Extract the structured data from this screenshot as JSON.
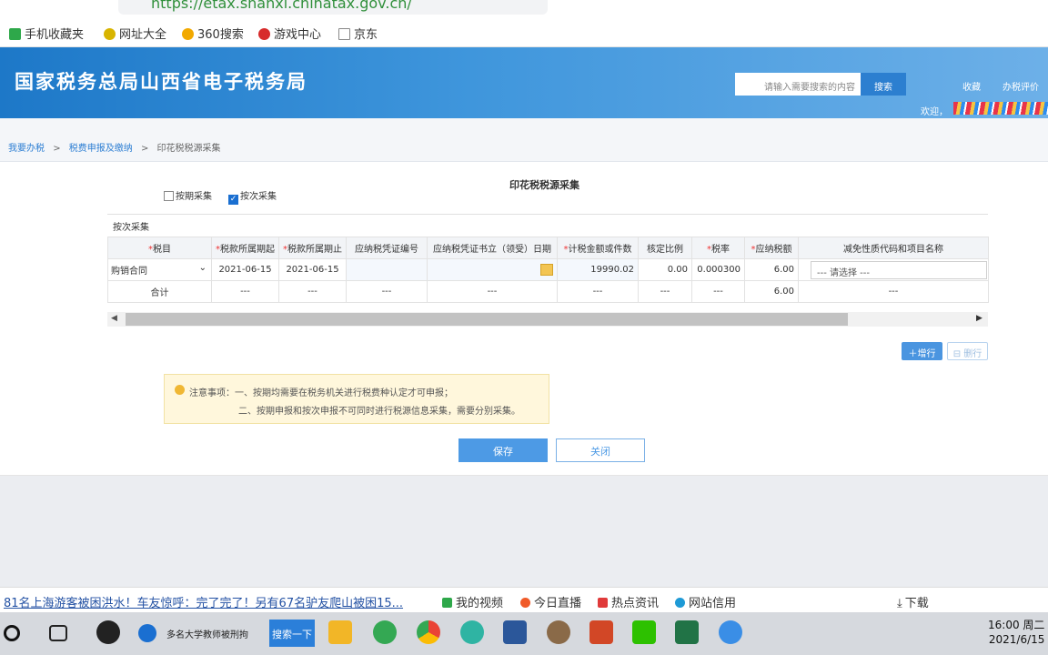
{
  "browser": {
    "address": "https://etax.shanxi.chinatax.gov.cn/",
    "bookmarks": [
      "手机收藏夹",
      "网址大全",
      "360搜索",
      "游戏中心",
      "京东"
    ]
  },
  "header": {
    "title": "国家税务总局山西省电子税务局",
    "search_placeholder": "请输入需要搜索的内容",
    "search_button": "搜索",
    "favorite": "收藏",
    "rate": "办税评价",
    "welcome": "欢迎，"
  },
  "breadcrumb": [
    "我要办税",
    "税费申报及缴纳",
    "印花税税源采集"
  ],
  "breadcrumb_sep": ">",
  "page_title": "印花税税源采集",
  "options": {
    "by_period": "按期采集",
    "by_time": "按次采集",
    "by_period_checked": false,
    "by_time_checked": true
  },
  "section_label": "按次采集",
  "table": {
    "headers": [
      {
        "text": "税目",
        "required": true
      },
      {
        "text": "税款所属期起",
        "required": true
      },
      {
        "text": "税款所属期止",
        "required": true
      },
      {
        "text": "应纳税凭证编号",
        "required": false
      },
      {
        "text": "应纳税凭证书立（领受）日期",
        "required": false
      },
      {
        "text": "计税金额或件数",
        "required": true
      },
      {
        "text": "核定比例",
        "required": false
      },
      {
        "text": "税率",
        "required": true
      },
      {
        "text": "应纳税额",
        "required": true
      },
      {
        "text": "减免性质代码和项目名称",
        "required": false
      }
    ],
    "row": {
      "item": "购销合同",
      "start": "2021-06-15",
      "end": "2021-06-15",
      "cert_no": "",
      "cert_date": "",
      "amount": "19990.02",
      "ratio": "0.00",
      "rate": "0.000300",
      "tax": "6.00",
      "relief": "--- 请选择 ---"
    },
    "total": {
      "label": "合计",
      "placeholder": "---",
      "tax": "6.00"
    }
  },
  "buttons": {
    "add_row": "＋增行",
    "delete_row": "⊟ 删行",
    "save": "保存",
    "close": "关闭"
  },
  "notice": {
    "line1": "注意事项：一、按期均需要在税务机关进行税费种认定才可申报；",
    "line2": "二、按期申报和按次申报不可同时进行税源信息采集，需要分别采集。"
  },
  "news": {
    "headline": "81名上海游客被困洪水！车友惊呼：完了完了！另有67名驴友爬山被困15...",
    "links": [
      "我的视频",
      "今日直播",
      "热点资讯",
      "网站信用",
      "下载"
    ]
  },
  "taskbar": {
    "active_window": "多名大学教师被刑拘",
    "search_button": "搜索一下",
    "time": "16:00 周二",
    "date": "2021/6/15"
  },
  "colors": {
    "banner": "#2f88d4",
    "primary": "#4d9ae5",
    "required": "#e33333",
    "notice_bg": "#fff7dc"
  }
}
